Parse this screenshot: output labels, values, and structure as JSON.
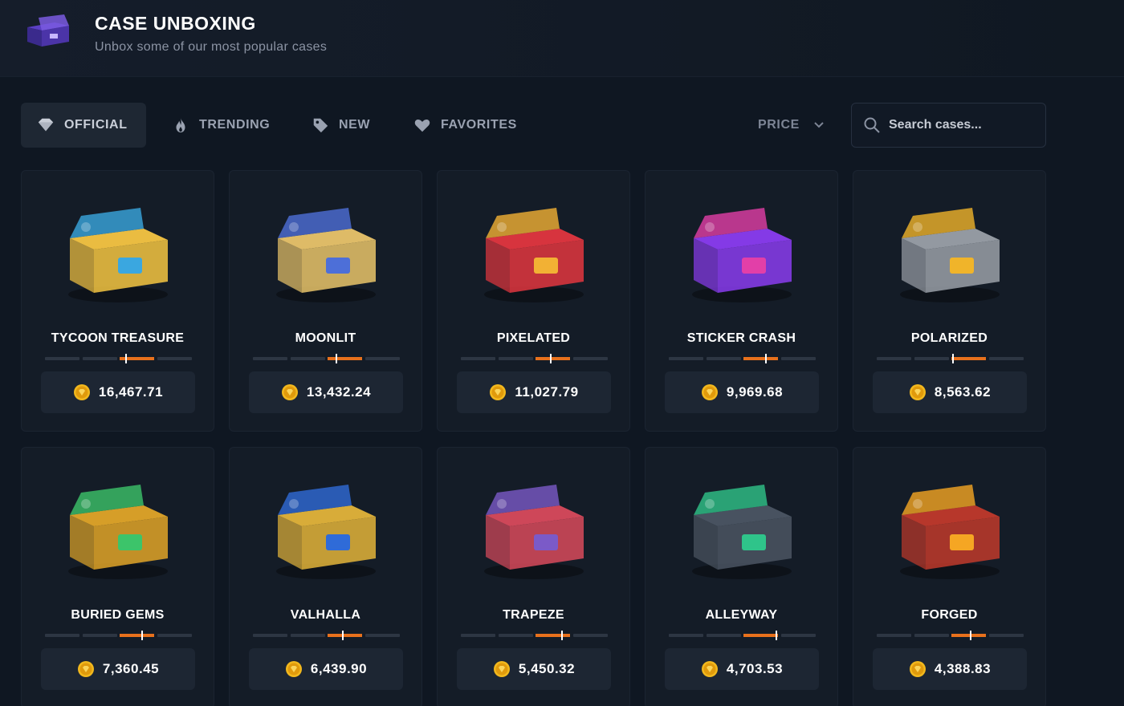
{
  "header": {
    "title": "CASE UNBOXING",
    "subtitle": "Unbox some of our most popular cases",
    "icon": "open-case-icon"
  },
  "tabs": [
    {
      "label": "OFFICIAL",
      "icon": "diamond-icon",
      "active": true
    },
    {
      "label": "TRENDING",
      "icon": "flame-icon",
      "active": false
    },
    {
      "label": "NEW",
      "icon": "tag-icon",
      "active": false
    },
    {
      "label": "FAVORITES",
      "icon": "heart-icon",
      "active": false
    }
  ],
  "sort": {
    "label": "PRICE",
    "icon": "chevron-down-icon"
  },
  "search": {
    "placeholder": "Search cases..."
  },
  "colors": {
    "background": "#0f1722",
    "card": "#141c27",
    "pill": "#1d2633",
    "accent": "#e8711c",
    "coin": "#f2b81d"
  },
  "cases": [
    {
      "name": "TYCOON TREASURE",
      "price": "16,467.71",
      "odds_level": 0.55,
      "theme": [
        "#f5c542",
        "#3aa7e0"
      ]
    },
    {
      "name": "MOONLIT",
      "price": "13,432.24",
      "odds_level": 0.57,
      "theme": [
        "#e9c46a",
        "#4d6fd8"
      ]
    },
    {
      "name": "PIXELATED",
      "price": "11,027.79",
      "odds_level": 0.61,
      "theme": [
        "#e2363f",
        "#f2b134"
      ]
    },
    {
      "name": "STICKER CRASH",
      "price": "9,969.68",
      "odds_level": 0.66,
      "theme": [
        "#8a3cf0",
        "#e23fa8"
      ]
    },
    {
      "name": "POLARIZED",
      "price": "8,563.62",
      "odds_level": 0.52,
      "theme": [
        "#9aa0a8",
        "#f0b42a"
      ]
    },
    {
      "name": "BURIED GEMS",
      "price": "7,360.45",
      "odds_level": 0.66,
      "theme": [
        "#e0a528",
        "#3cc46a"
      ]
    },
    {
      "name": "VALHALLA",
      "price": "6,439.90",
      "odds_level": 0.61,
      "theme": [
        "#e3b43a",
        "#2f6bd8"
      ]
    },
    {
      "name": "TRAPEZE",
      "price": "5,450.32",
      "odds_level": 0.69,
      "theme": [
        "#d84a5c",
        "#7b5ac8"
      ]
    },
    {
      "name": "ALLEYWAY",
      "price": "4,703.53",
      "odds_level": 0.73,
      "theme": [
        "#4b5563",
        "#2fc48a"
      ]
    },
    {
      "name": "FORGED",
      "price": "4,388.83",
      "odds_level": 0.64,
      "theme": [
        "#c0392b",
        "#f5a623"
      ]
    }
  ]
}
